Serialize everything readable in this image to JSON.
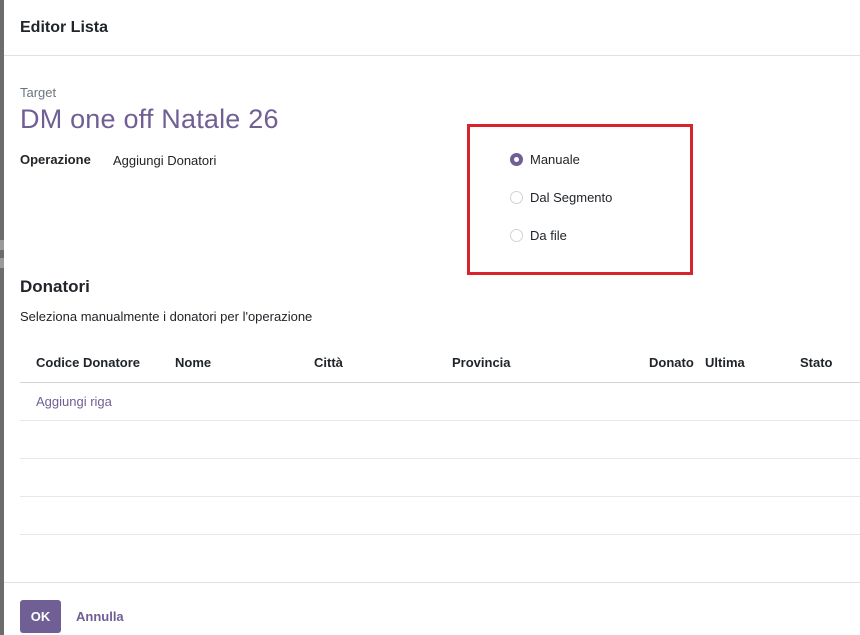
{
  "dialog": {
    "title": "Editor Lista",
    "target_label": "Target",
    "target_name": "DM one off Natale 26",
    "operation_label": "Operazione",
    "operation_value": "Aggiungi Donatori"
  },
  "source_options": [
    {
      "label": "Manuale",
      "checked": true
    },
    {
      "label": "Dal Segmento",
      "checked": false
    },
    {
      "label": "Da file",
      "checked": false
    }
  ],
  "donors_section": {
    "title": "Donatori",
    "description": "Seleziona manualmente i donatori per l'operazione",
    "columns": [
      "Codice Donatore",
      "Nome",
      "Città",
      "Provincia",
      "Donato",
      "Ultima",
      "Stato"
    ],
    "add_line_label": "Aggiungi riga"
  },
  "footer": {
    "ok_label": "OK",
    "cancel_label": "Annulla"
  },
  "colors": {
    "accent": "#6f5f94",
    "highlight": "#d9232a"
  }
}
